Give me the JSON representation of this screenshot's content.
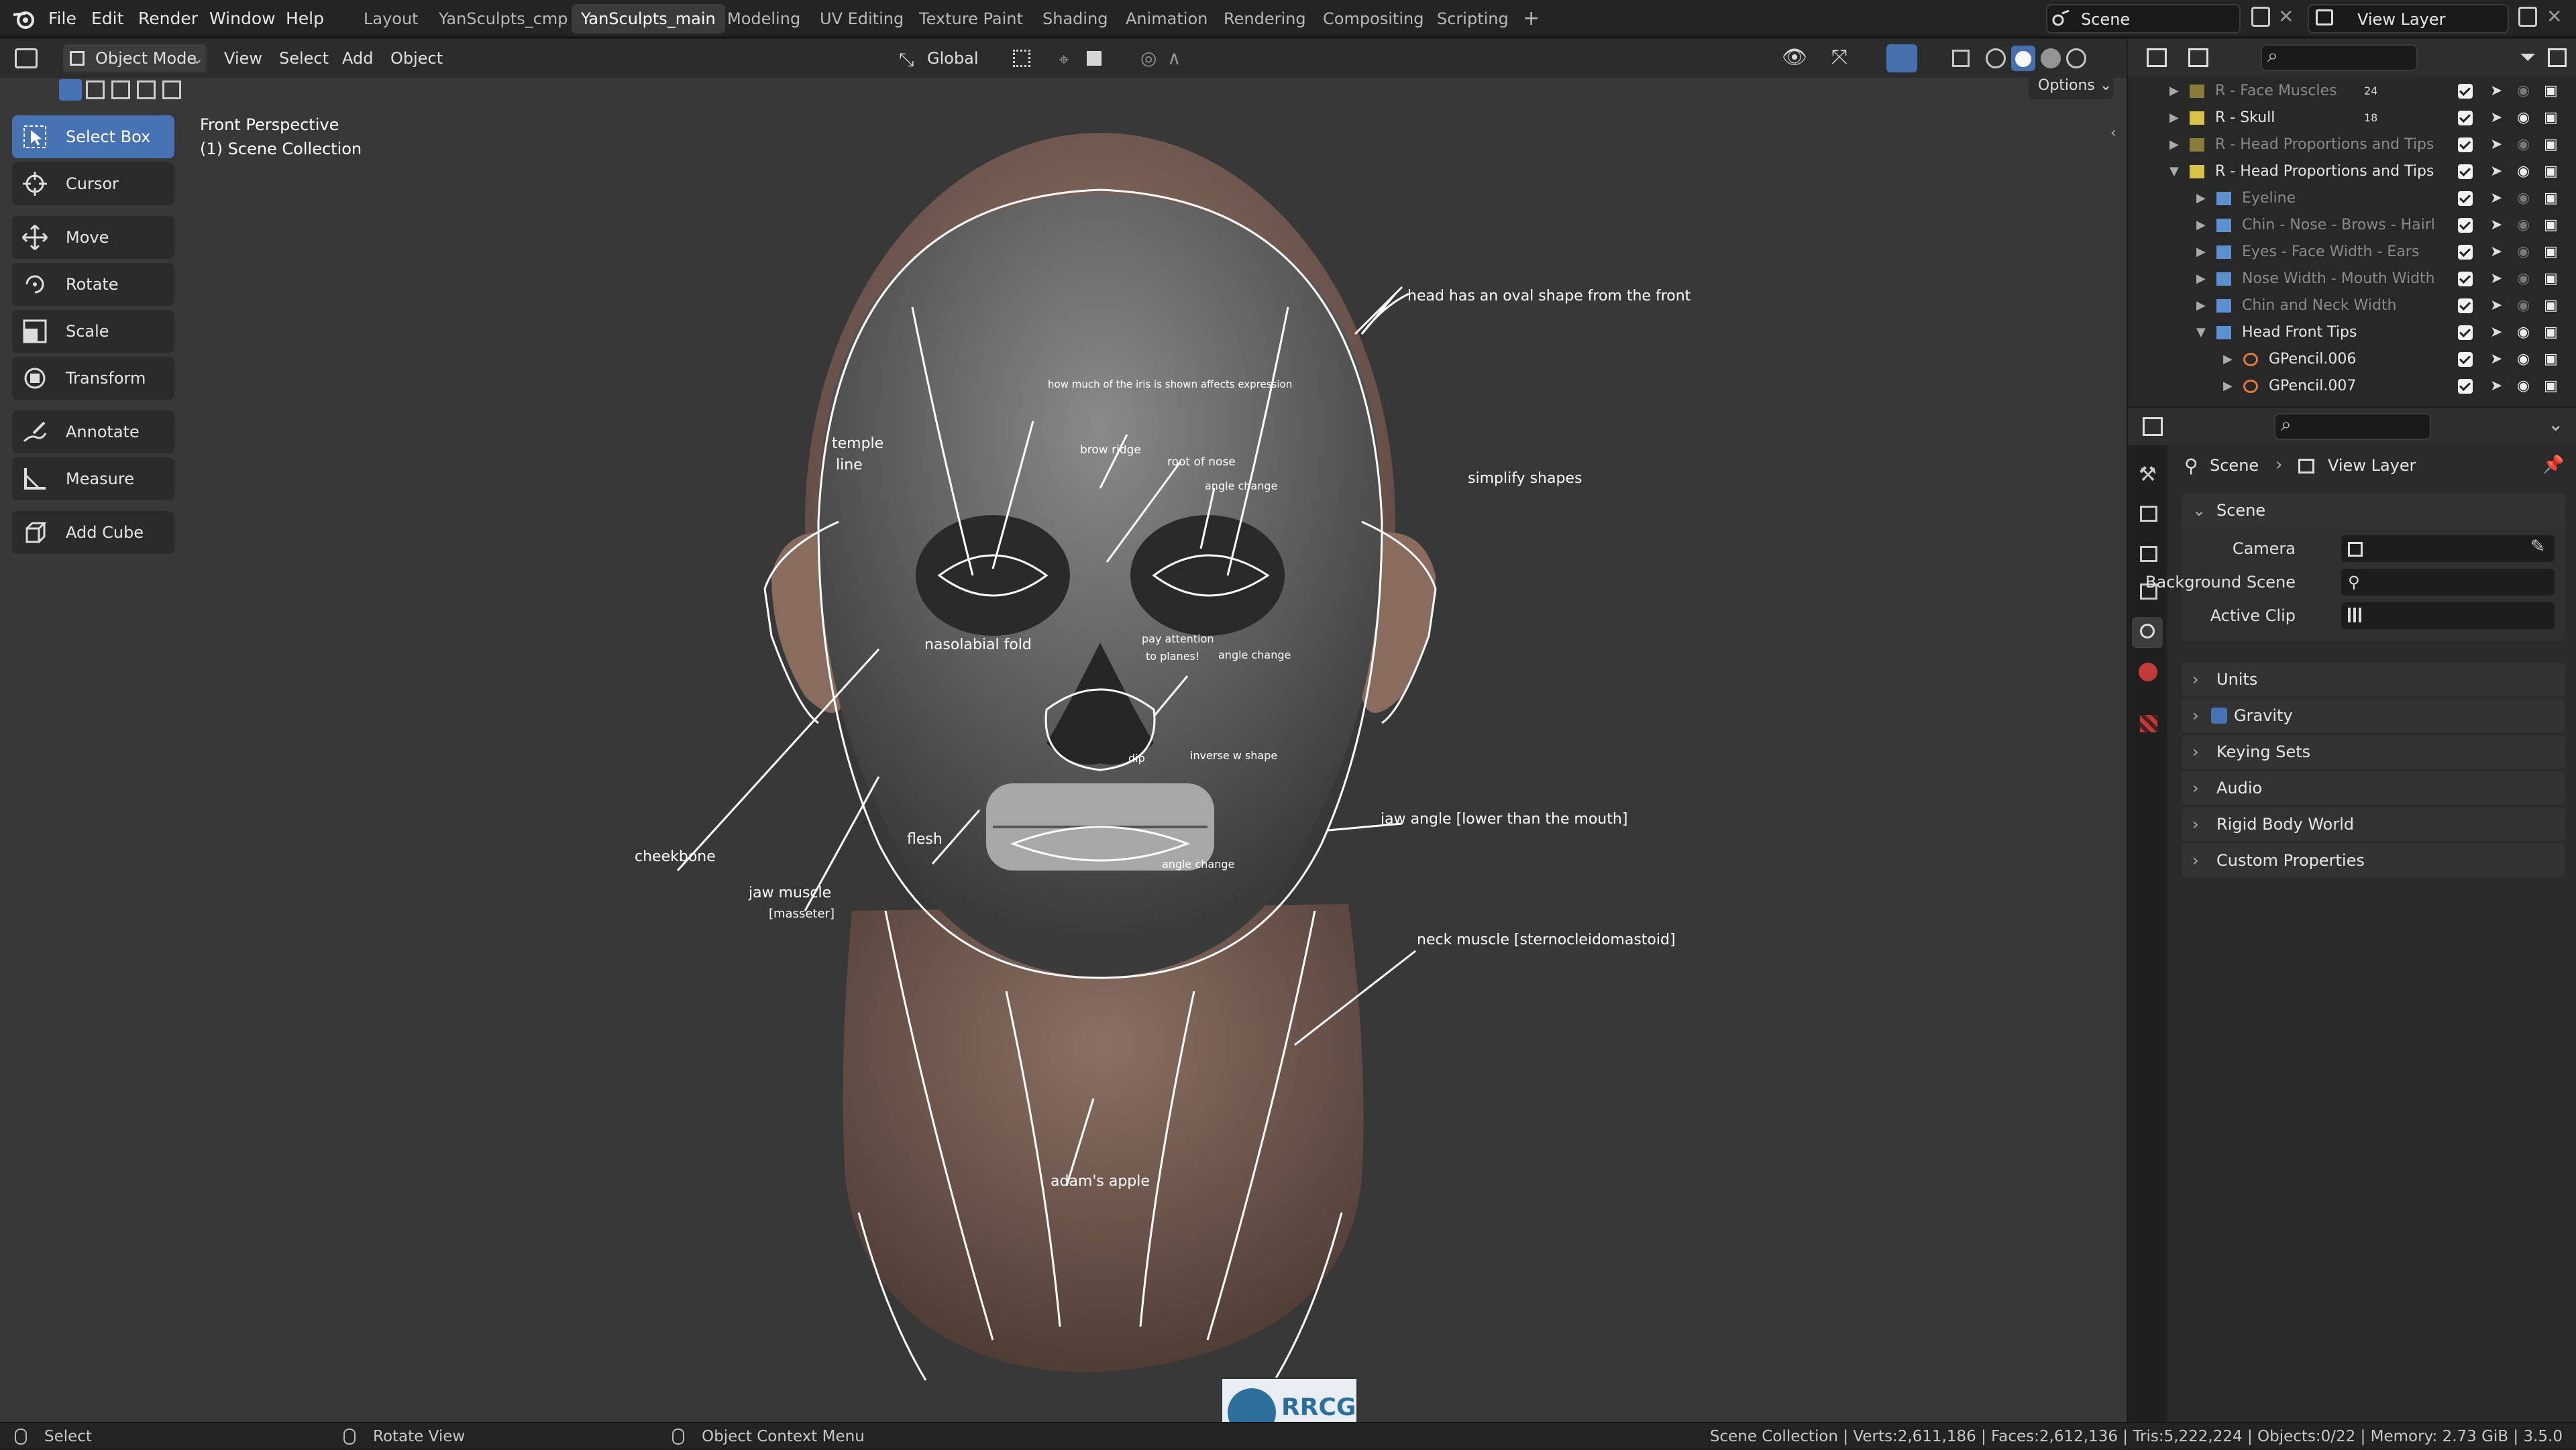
{
  "menu": [
    "File",
    "Edit",
    "Render",
    "Window",
    "Help"
  ],
  "workspaces": [
    "Layout",
    "YanSculpts_cmp",
    "YanSculpts_main",
    "Modeling",
    "UV Editing",
    "Texture Paint",
    "Shading",
    "Animation",
    "Rendering",
    "Compositing",
    "Scripting"
  ],
  "active_workspace": "YanSculpts_main",
  "scene_field": "Scene",
  "view_layer_field": "View Layer",
  "viewport": {
    "mode": "Object Mode",
    "menus": [
      "View",
      "Select",
      "Add",
      "Object"
    ],
    "transform_orientation": "Global",
    "options_label": "Options",
    "overlay_line1": "Front Perspective",
    "overlay_line2": "(1) Scene Collection"
  },
  "tools": [
    "Select Box",
    "Cursor",
    "Move",
    "Rotate",
    "Scale",
    "Transform",
    "Annotate",
    "Measure",
    "Add Cube"
  ],
  "active_tool": "Select Box",
  "annotations": {
    "head_oval": "head has an oval shape from the front",
    "iris": "how much of the iris is shown affects expression",
    "temple": "temple",
    "temple2": "line",
    "brow_ridge": "brow ridge",
    "root_nose": "root of nose",
    "angle1": "angle change",
    "simplify": "simplify shapes",
    "nasolabial": "nasolabial fold",
    "planes1": "pay attention",
    "planes2": "to planes!",
    "angle2": "angle change",
    "dip": "dip",
    "inverse_w": "inverse w shape",
    "cheekbone": "cheekbone",
    "flesh": "flesh",
    "jaw_angle": "jaw angle [lower than the mouth]",
    "angle3": "angle change",
    "jaw_muscle": "jaw muscle",
    "masseter": "[masseter]",
    "neck_muscle": "neck muscle [sternocleidomastoid]",
    "adams_apple": "adam's apple"
  },
  "watermark": "RRCG",
  "outliner": [
    {
      "label": "R - Face Muscles",
      "badge": "24",
      "indent": 0,
      "expanded": false,
      "dim": true
    },
    {
      "label": "R - Skull",
      "badge": "18",
      "indent": 0,
      "expanded": false,
      "dim": false
    },
    {
      "label": "R - Head Proportions and Tips",
      "badge": "",
      "indent": 0,
      "expanded": false,
      "dim": true
    },
    {
      "label": "R - Head Proportions and Tips",
      "badge": "",
      "indent": 0,
      "expanded": true,
      "dim": false
    },
    {
      "label": "Eyeline",
      "badge": "",
      "indent": 1,
      "expanded": false,
      "dim": true
    },
    {
      "label": "Chin - Nose - Brows - Hairl",
      "badge": "",
      "indent": 1,
      "expanded": false,
      "dim": true
    },
    {
      "label": "Eyes - Face Width - Ears",
      "badge": "",
      "indent": 1,
      "expanded": false,
      "dim": true
    },
    {
      "label": "Nose Width - Mouth Width",
      "badge": "",
      "indent": 1,
      "expanded": false,
      "dim": true
    },
    {
      "label": "Chin and Neck Width",
      "badge": "",
      "indent": 1,
      "expanded": false,
      "dim": true
    },
    {
      "label": "Head Front Tips",
      "badge": "",
      "indent": 1,
      "expanded": true,
      "dim": false
    },
    {
      "label": "GPencil.006",
      "badge": "",
      "indent": 2,
      "expanded": false,
      "dim": false
    },
    {
      "label": "GPencil.007",
      "badge": "",
      "indent": 2,
      "expanded": false,
      "dim": false
    }
  ],
  "properties": {
    "breadcrumb_scene": "Scene",
    "breadcrumb_layer": "View Layer",
    "scene_panel": "Scene",
    "camera_label": "Camera",
    "bg_scene_label": "Background Scene",
    "active_clip_label": "Active Clip",
    "panels": [
      "Units",
      "Gravity",
      "Keying Sets",
      "Audio",
      "Rigid Body World",
      "Custom Properties"
    ]
  },
  "status": {
    "select": "Select",
    "rotate_view": "Rotate View",
    "context_menu": "Object Context Menu",
    "stats": "Scene Collection | Verts:2,611,186 | Faces:2,612,136 | Tris:5,222,224 | Objects:0/22 | Memory: 2.73 GiB | 3.5.0"
  }
}
